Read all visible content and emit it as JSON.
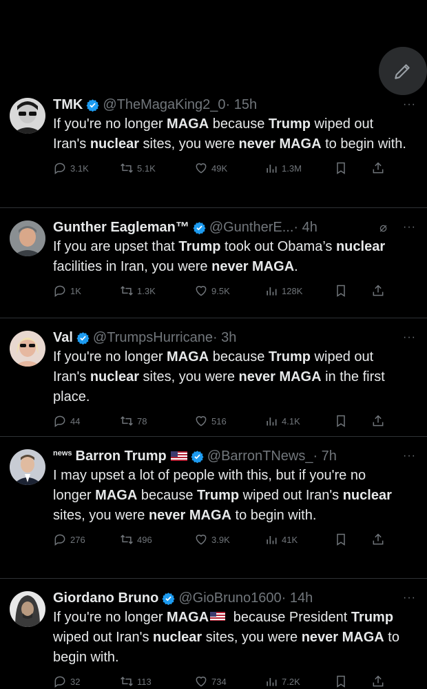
{
  "tweets": [
    {
      "name": "TMK",
      "handle": "@TheMagaKing2_0",
      "time": "· 15h",
      "text_html": "If you're no longer <b>MAGA</b> because <b>Trump</b> wiped out Iran's <b>nuclear</b> sites, you were <b>never MAGA</b> to begin with.",
      "stats": {
        "replies": "3.1K",
        "retweets": "5.1K",
        "likes": "49K",
        "views": "1.3M"
      }
    },
    {
      "name": "Gunther Eagleman™",
      "handle": "@GuntherE...",
      "time": "· 4h",
      "text_html": "If you are upset that <b>Trump</b> took out Obama’s <b>nuclear</b> facilities in Iran, you were <b>never MAGA</b>.",
      "stats": {
        "replies": "1K",
        "retweets": "1.3K",
        "likes": "9.5K",
        "views": "128K"
      }
    },
    {
      "name": "Val",
      "handle": "@TrumpsHurricane",
      "time": "· 3h",
      "text_html": "If you're no longer <b>MAGA</b> because <b>Trump</b> wiped out Iran's <b>nuclear</b> sites, you were <b>never MAGA</b> in the first place.",
      "stats": {
        "replies": "44",
        "retweets": "78",
        "likes": "516",
        "views": "4.1K"
      }
    },
    {
      "news_tag": "news",
      "name": "Barron Trump",
      "handle": "@BarronTNews_",
      "time": "· 7h",
      "text_html": "I may upset a lot of people with this, but if you're no longer <b>MAGA</b> because <b>Trump</b> wiped out Iran's <b>nuclear</b> sites, you were <b>never MAGA</b> to begin with.",
      "stats": {
        "replies": "276",
        "retweets": "496",
        "likes": "3.9K",
        "views": "41K"
      }
    },
    {
      "name": "Giordano Bruno",
      "handle": "@GioBruno1600",
      "time": "· 14h",
      "text_html": "If you're no longer <b>MAGA</b><span class=\"flag inline\" data-name=\"us-flag-emoji\" data-interactable=\"false\"></span> because President <b>Trump</b> wiped out Iran's <b>nuclear</b> sites, you were <b>never MAGA</b> to begin with.",
      "stats": {
        "replies": "32",
        "retweets": "113",
        "likes": "734",
        "views": "7.2K"
      }
    }
  ],
  "icons": {
    "compose": "feather-compose-icon",
    "verified": "verified-badge-icon",
    "reply": "reply-icon",
    "retweet": "retweet-icon",
    "like": "heart-icon",
    "views": "views-icon",
    "bookmark": "bookmark-icon",
    "share": "share-icon",
    "more": "more-icon",
    "grok": "grok-icon"
  },
  "colors": {
    "background": "#000000",
    "text": "#e7e9ea",
    "muted": "#71767b",
    "verified": "#1d9bf0",
    "divider": "#2f3336"
  }
}
